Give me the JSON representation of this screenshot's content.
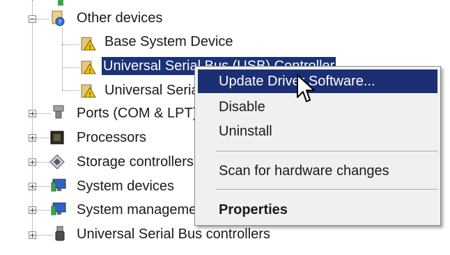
{
  "tree": {
    "other_devices": "Other devices",
    "base_system_device": "Base System Device",
    "usb_controller_selected": "Universal Serial Bus (USB) Controller",
    "usb_controller_2": "Universal Serial Bus (USB) Controller",
    "ports": "Ports (COM & LPT)",
    "processors": "Processors",
    "storage_controllers": "Storage controllers",
    "system_devices": "System devices",
    "system_management": "System management",
    "usb_controllers": "Universal Serial Bus controllers"
  },
  "context_menu": {
    "update_driver": "Update Driver Software...",
    "disable": "Disable",
    "uninstall": "Uninstall",
    "scan": "Scan for hardware changes",
    "properties": "Properties"
  },
  "colors": {
    "selection": "#1b3279",
    "menu_background": "#f0f0f0"
  },
  "icons": {
    "unknown_device": "unknown-device-icon",
    "warning_device": "warning-device-icon",
    "ports": "port-connector-icon",
    "processor": "processor-chip-icon",
    "storage": "storage-controller-icon",
    "system": "computer-monitor-icon",
    "usb": "usb-plug-icon"
  }
}
